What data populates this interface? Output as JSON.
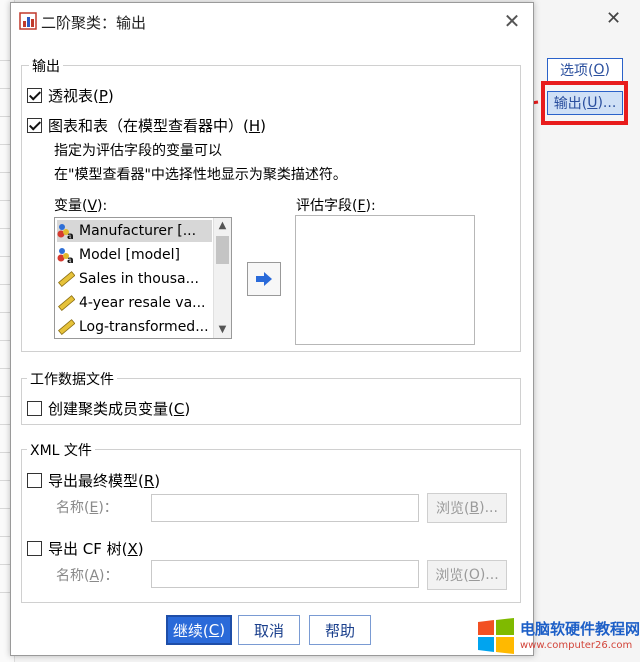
{
  "dialog": {
    "title": "二阶聚类：输出",
    "close": "✕"
  },
  "output_group": {
    "title": "输出",
    "pivot_tables": {
      "label": "透视表(",
      "key": "P",
      "suffix": ")",
      "checked": true
    },
    "charts_tables": {
      "label": "图表和表（在模型查看器中）(",
      "key": "H",
      "suffix": ")",
      "checked": true
    },
    "desc_line1": "指定为评估字段的变量可以",
    "desc_line2": "在\"模型查看器\"中选择性地显示为聚类描述符。",
    "variables_label": "变量(",
    "variables_key": "V",
    "variables_suffix": "):",
    "eval_label": "评估字段(",
    "eval_key": "F",
    "eval_suffix": "):",
    "variables": [
      {
        "text": "Manufacturer [...",
        "icon": "nominal-string-icon",
        "selected": true
      },
      {
        "text": "Model [model]",
        "icon": "nominal-string-icon",
        "selected": false
      },
      {
        "text": "Sales in thousa...",
        "icon": "scale-ruler-icon",
        "selected": false
      },
      {
        "text": "4-year resale va...",
        "icon": "scale-ruler-icon",
        "selected": false
      },
      {
        "text": "Log-transformed...",
        "icon": "scale-ruler-icon",
        "selected": false
      }
    ]
  },
  "working_data": {
    "title": "工作数据文件",
    "create_var": {
      "label": "创建聚类成员变量(",
      "key": "C",
      "suffix": ")",
      "checked": false
    }
  },
  "xml": {
    "title": "XML 文件",
    "export_model": {
      "label": "导出最终模型(",
      "key": "R",
      "suffix": ")",
      "checked": false
    },
    "name1": {
      "label": "名称(",
      "key": "E",
      "suffix": ")：",
      "value": ""
    },
    "browse1": {
      "label": "浏览(",
      "key": "B",
      "suffix": ")..."
    },
    "export_cf": {
      "label": "导出 CF 树(",
      "key": "X",
      "suffix": ")",
      "checked": false
    },
    "name2": {
      "label": "名称(",
      "key": "A",
      "suffix": ")：",
      "value": ""
    },
    "browse2": {
      "label": "浏览(",
      "key": "O",
      "suffix": ")..."
    }
  },
  "footer": {
    "continue": {
      "label": "继续(",
      "key": "C",
      "suffix": ")"
    },
    "cancel": "取消",
    "help": "帮助"
  },
  "background": {
    "options_button": {
      "label": "选项(",
      "key": "O",
      "suffix": ")"
    },
    "output_button": {
      "label": "输出(",
      "key": "U",
      "suffix": ")..."
    },
    "close": "✕"
  },
  "watermark": {
    "text": "电脑软硬件教程网",
    "url": "www.computer26.com"
  },
  "colors": {
    "highlight": "#e81c1c",
    "primary_button": "#2a6ad9",
    "link_blue": "#1a3f8c"
  }
}
